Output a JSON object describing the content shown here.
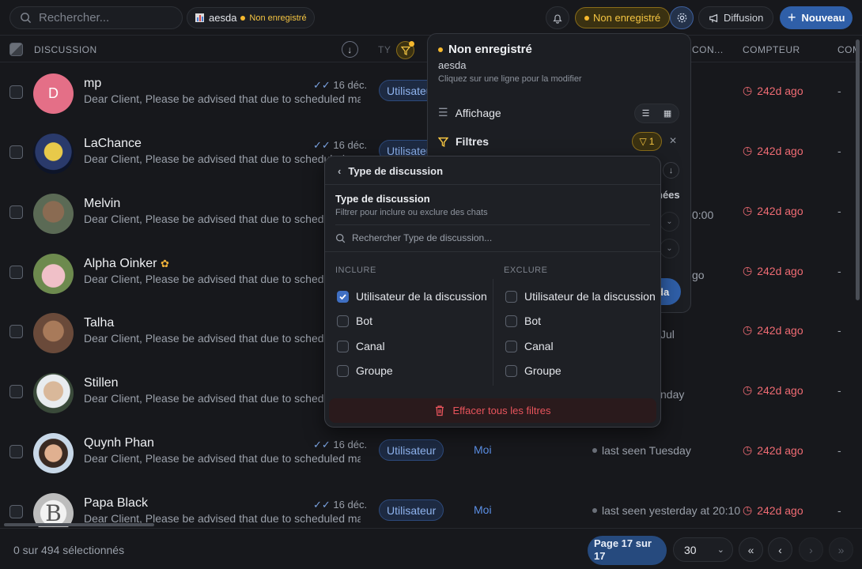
{
  "topbar": {
    "search_placeholder": "Rechercher...",
    "workspace_name": "aesda",
    "workspace_status": "Non enregistré",
    "status_pill": "Non enregistré",
    "diffusion_label": "Diffusion",
    "new_label": "Nouveau"
  },
  "columns": {
    "discussion": "DISCUSSION",
    "type_partial": "TY",
    "contact_partial": "CON...",
    "counter": "COMPTEUR",
    "extra_partial": "COM"
  },
  "rows": [
    {
      "name": "mp",
      "date": "16 déc.",
      "preview": "Dear Client, Please be advised that due to scheduled ma...",
      "type": "Utilisateur",
      "owner": "",
      "seen": "",
      "counter": "242d ago",
      "extra": "-",
      "avatar_letter": "D",
      "avatar_color": "#e46f87"
    },
    {
      "name": "LaChance",
      "date": "16 déc.",
      "preview": "Dear Client, Please be advised that due to scheduled ma...",
      "type": "Utilisateur",
      "owner": "",
      "seen": "",
      "counter": "242d ago",
      "extra": "-"
    },
    {
      "name": "Melvin",
      "date": "",
      "preview": "Dear Client, Please be advised that due to scheduled ma...",
      "type": "",
      "owner": "",
      "seen": "0:00",
      "counter": "242d ago",
      "extra": "-"
    },
    {
      "name": "Alpha Oinker",
      "date": "",
      "preview": "Dear Client, Please be advised that due to scheduled ma...",
      "type": "",
      "owner": "",
      "seen": "go",
      "counter": "242d ago",
      "extra": "-"
    },
    {
      "name": "Talha",
      "date": "",
      "preview": "Dear Client, Please be advised that due to scheduled ma...",
      "type": "",
      "owner": "",
      "seen": "Jul",
      "counter": "242d ago",
      "extra": "-"
    },
    {
      "name": "Stillen",
      "date": "",
      "preview": "Dear Client, Please be advised that due to scheduled ma...",
      "type": "",
      "owner": "",
      "seen": "nday",
      "counter": "242d ago",
      "extra": "-"
    },
    {
      "name": "Quynh Phan",
      "date": "16 déc.",
      "preview": "Dear Client, Please be advised that due to scheduled ma...",
      "type": "Utilisateur",
      "owner": "Moi",
      "seen": "last seen Tuesday",
      "counter": "242d ago",
      "extra": "-"
    },
    {
      "name": "Papa Black",
      "date": "16 déc.",
      "preview": "Dear Client, Please be advised that due to scheduled ma...",
      "type": "Utilisateur",
      "owner": "Moi",
      "seen": "last seen yesterday at 20:10",
      "counter": "242d ago",
      "extra": "-"
    }
  ],
  "settings_panel": {
    "title": "Non enregistré",
    "workspace": "aesda",
    "hint": "Cliquez sur une ligne pour la modifier",
    "display_label": "Affichage",
    "filters_label": "Filtres",
    "filter_count": "1",
    "partial_text": "nées",
    "partial_button": "da"
  },
  "filter_dropdown": {
    "back_label": "Type de discussion",
    "title": "Type de discussion",
    "description": "Filtrer pour inclure ou exclure des chats",
    "search_placeholder": "Rechercher Type de discussion...",
    "include_header": "INCLURE",
    "exclude_header": "EXCLURE",
    "include_options": [
      {
        "label": "Utilisateur de la discussion",
        "checked": true
      },
      {
        "label": "Bot",
        "checked": false
      },
      {
        "label": "Canal",
        "checked": false
      },
      {
        "label": "Groupe",
        "checked": false
      }
    ],
    "exclude_options": [
      {
        "label": "Utilisateur de la discussion",
        "checked": false
      },
      {
        "label": "Bot",
        "checked": false
      },
      {
        "label": "Canal",
        "checked": false
      },
      {
        "label": "Groupe",
        "checked": false
      }
    ],
    "clear_label": "Effacer tous les filtres"
  },
  "footer": {
    "selection": "0 sur 494 sélectionnés",
    "page_label": "Page 17 sur 17",
    "per_page": "30"
  },
  "colors": {
    "accent": "#2f5fa8",
    "warning": "#f5c542",
    "danger": "#ef6b73"
  }
}
